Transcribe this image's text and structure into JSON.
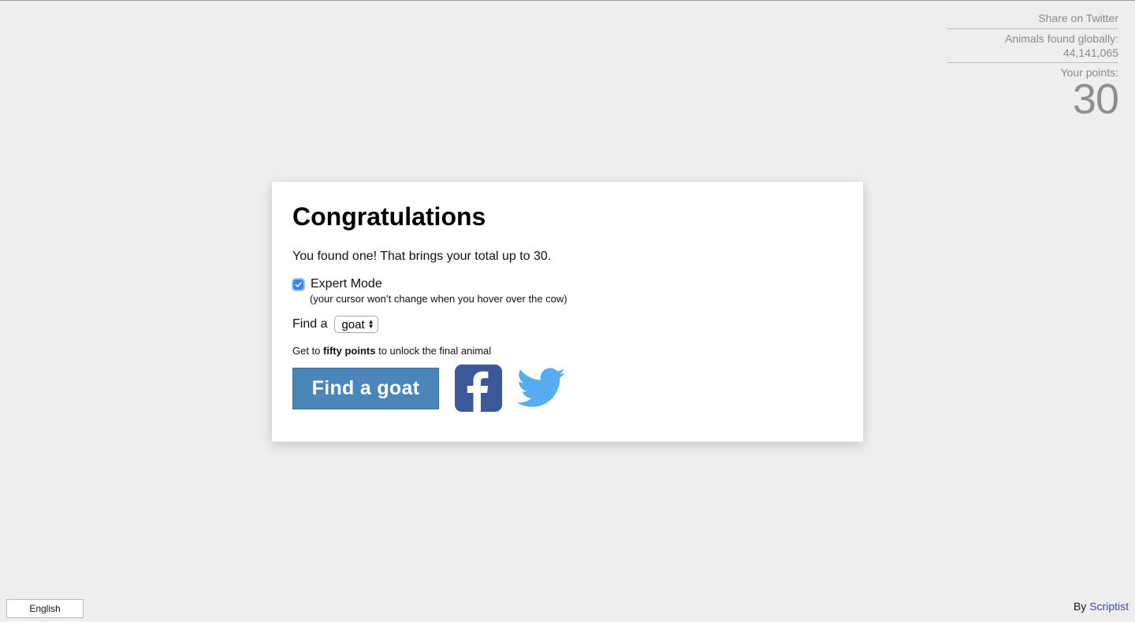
{
  "stats": {
    "share_label": "Share on Twitter",
    "found_label": "Animals found globally: 44,141,065",
    "points_label": "Your points:",
    "points_value": "30"
  },
  "dialog": {
    "title": "Congratulations",
    "message": "You found one! That brings your total up to 30.",
    "expert_mode": {
      "label": "Expert Mode",
      "checked": true,
      "note": "(your cursor won’t change when you hover over the cow)"
    },
    "find": {
      "label": "Find a",
      "selected": "goat"
    },
    "unlock": {
      "prefix": "Get to ",
      "bold": "fifty points",
      "suffix": " to unlock the final animal"
    },
    "find_button_label": "Find a goat",
    "facebook_icon": "facebook-icon",
    "twitter_icon": "twitter-icon"
  },
  "footer": {
    "language": "English",
    "credit_prefix": "By ",
    "credit_link": "Scriptist"
  },
  "colors": {
    "background": "#eeeeee",
    "button_blue": "#4a86b9",
    "facebook_blue": "#3b5998",
    "twitter_blue": "#55acee",
    "checkbox_blue": "#3b82f6",
    "link_blue": "#3b48b4"
  }
}
